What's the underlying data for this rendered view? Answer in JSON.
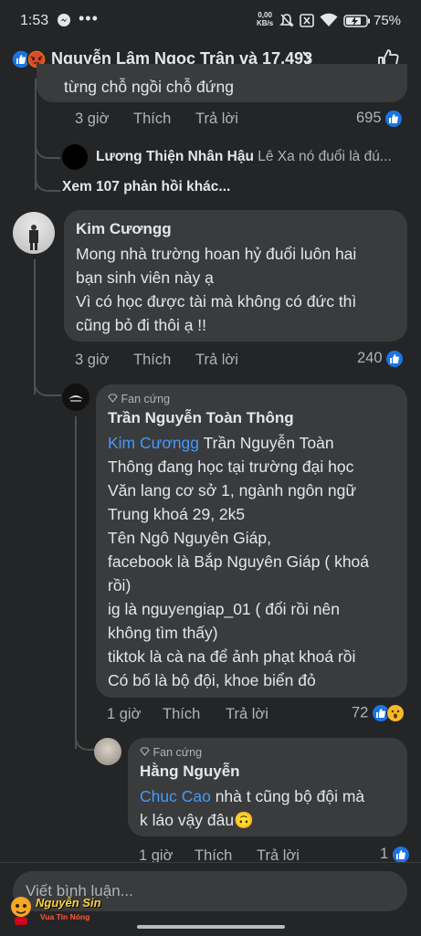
{
  "status": {
    "time": "1:53",
    "net_speed_top": "0,00",
    "net_speed_unit": "KB/s",
    "battery": "75%"
  },
  "header": {
    "title": "Nguyễn Lâm Ngọc Trân và 17.493"
  },
  "prev_comment": {
    "text_tail": "từng chỗ ngồi chỗ đứng",
    "time": "3 giờ",
    "like": "Thích",
    "reply": "Trả lời",
    "count": "695"
  },
  "reply_preview": {
    "name": "Lương Thiện Nhân Hậu",
    "text": "Lê Xa nó đuổi là đú..."
  },
  "more_replies": "Xem 107 phản hồi khác...",
  "comment1": {
    "name": "Kim Cươngg",
    "lines": [
      "Mong nhà trường hoan hỷ đuổi luôn hai",
      "bạn sinh viên này ạ",
      "Vì có học được tài mà không có đức thì",
      "cũng bỏ đi thôi ạ !!"
    ],
    "time": "3 giờ",
    "like": "Thích",
    "reply": "Trả lời",
    "count": "240"
  },
  "comment2": {
    "badge": "Fan cứng",
    "name": "Trần Nguyễn Toàn Thông",
    "mention": "Kim Cươngg",
    "first_rest": " Trần Nguyễn Toàn",
    "lines": [
      "Thông đang học tại trường đại học",
      "Văn lang cơ sở 1, ngành ngôn ngữ",
      "Trung khoá 29, 2k5",
      "Tên Ngô Nguyên Giáp,",
      "facebook là Bắp Nguyên Giáp ( khoá",
      "rồi)",
      "ig là nguyengiap_01 ( đổi rồi nên",
      "không tìm thấy)",
      "tiktok là cà na để ảnh phạt khoá rồi",
      "Có bố là bộ đội, khoe biển đỏ"
    ],
    "time": "1 giờ",
    "like": "Thích",
    "reply": "Trả lời",
    "count": "72"
  },
  "comment3": {
    "badge": "Fan cứng",
    "name": "Hằng Nguyễn",
    "mention": "Chuc Cao",
    "first_rest": " nhà t cũng bộ đội mà",
    "line2": "k láo vậy đâu🙃",
    "time": "1 giờ",
    "like": "Thích",
    "reply": "Trả lời",
    "count": "1"
  },
  "composer": {
    "placeholder": "Viết bình luận..."
  },
  "watermark": {
    "line1": "Nguyễn Sin",
    "line2": "Vua Tin Nóng"
  },
  "colors": {
    "bg": "#242526",
    "bubble": "#3a3b3c",
    "link": "#4599ff",
    "like_blue": "#1b74e4"
  }
}
